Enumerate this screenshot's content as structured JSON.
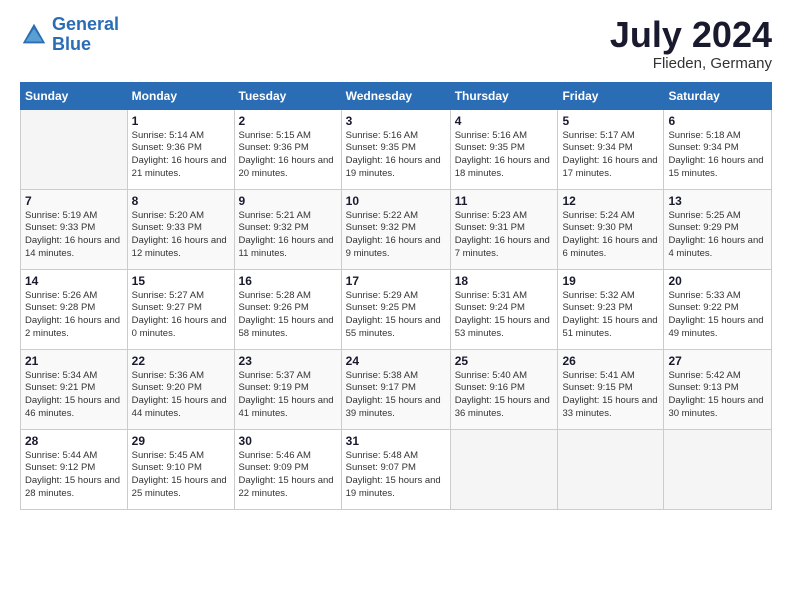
{
  "header": {
    "logo_line1": "General",
    "logo_line2": "Blue",
    "month": "July 2024",
    "location": "Flieden, Germany"
  },
  "weekdays": [
    "Sunday",
    "Monday",
    "Tuesday",
    "Wednesday",
    "Thursday",
    "Friday",
    "Saturday"
  ],
  "weeks": [
    [
      {
        "day": "",
        "empty": true
      },
      {
        "day": "1",
        "rise": "5:14 AM",
        "set": "9:36 PM",
        "daylight": "16 hours and 21 minutes."
      },
      {
        "day": "2",
        "rise": "5:15 AM",
        "set": "9:36 PM",
        "daylight": "16 hours and 20 minutes."
      },
      {
        "day": "3",
        "rise": "5:16 AM",
        "set": "9:35 PM",
        "daylight": "16 hours and 19 minutes."
      },
      {
        "day": "4",
        "rise": "5:16 AM",
        "set": "9:35 PM",
        "daylight": "16 hours and 18 minutes."
      },
      {
        "day": "5",
        "rise": "5:17 AM",
        "set": "9:34 PM",
        "daylight": "16 hours and 17 minutes."
      },
      {
        "day": "6",
        "rise": "5:18 AM",
        "set": "9:34 PM",
        "daylight": "16 hours and 15 minutes."
      }
    ],
    [
      {
        "day": "7",
        "rise": "5:19 AM",
        "set": "9:33 PM",
        "daylight": "16 hours and 14 minutes."
      },
      {
        "day": "8",
        "rise": "5:20 AM",
        "set": "9:33 PM",
        "daylight": "16 hours and 12 minutes."
      },
      {
        "day": "9",
        "rise": "5:21 AM",
        "set": "9:32 PM",
        "daylight": "16 hours and 11 minutes."
      },
      {
        "day": "10",
        "rise": "5:22 AM",
        "set": "9:32 PM",
        "daylight": "16 hours and 9 minutes."
      },
      {
        "day": "11",
        "rise": "5:23 AM",
        "set": "9:31 PM",
        "daylight": "16 hours and 7 minutes."
      },
      {
        "day": "12",
        "rise": "5:24 AM",
        "set": "9:30 PM",
        "daylight": "16 hours and 6 minutes."
      },
      {
        "day": "13",
        "rise": "5:25 AM",
        "set": "9:29 PM",
        "daylight": "16 hours and 4 minutes."
      }
    ],
    [
      {
        "day": "14",
        "rise": "5:26 AM",
        "set": "9:28 PM",
        "daylight": "16 hours and 2 minutes."
      },
      {
        "day": "15",
        "rise": "5:27 AM",
        "set": "9:27 PM",
        "daylight": "16 hours and 0 minutes."
      },
      {
        "day": "16",
        "rise": "5:28 AM",
        "set": "9:26 PM",
        "daylight": "15 hours and 58 minutes."
      },
      {
        "day": "17",
        "rise": "5:29 AM",
        "set": "9:25 PM",
        "daylight": "15 hours and 55 minutes."
      },
      {
        "day": "18",
        "rise": "5:31 AM",
        "set": "9:24 PM",
        "daylight": "15 hours and 53 minutes."
      },
      {
        "day": "19",
        "rise": "5:32 AM",
        "set": "9:23 PM",
        "daylight": "15 hours and 51 minutes."
      },
      {
        "day": "20",
        "rise": "5:33 AM",
        "set": "9:22 PM",
        "daylight": "15 hours and 49 minutes."
      }
    ],
    [
      {
        "day": "21",
        "rise": "5:34 AM",
        "set": "9:21 PM",
        "daylight": "15 hours and 46 minutes."
      },
      {
        "day": "22",
        "rise": "5:36 AM",
        "set": "9:20 PM",
        "daylight": "15 hours and 44 minutes."
      },
      {
        "day": "23",
        "rise": "5:37 AM",
        "set": "9:19 PM",
        "daylight": "15 hours and 41 minutes."
      },
      {
        "day": "24",
        "rise": "5:38 AM",
        "set": "9:17 PM",
        "daylight": "15 hours and 39 minutes."
      },
      {
        "day": "25",
        "rise": "5:40 AM",
        "set": "9:16 PM",
        "daylight": "15 hours and 36 minutes."
      },
      {
        "day": "26",
        "rise": "5:41 AM",
        "set": "9:15 PM",
        "daylight": "15 hours and 33 minutes."
      },
      {
        "day": "27",
        "rise": "5:42 AM",
        "set": "9:13 PM",
        "daylight": "15 hours and 30 minutes."
      }
    ],
    [
      {
        "day": "28",
        "rise": "5:44 AM",
        "set": "9:12 PM",
        "daylight": "15 hours and 28 minutes."
      },
      {
        "day": "29",
        "rise": "5:45 AM",
        "set": "9:10 PM",
        "daylight": "15 hours and 25 minutes."
      },
      {
        "day": "30",
        "rise": "5:46 AM",
        "set": "9:09 PM",
        "daylight": "15 hours and 22 minutes."
      },
      {
        "day": "31",
        "rise": "5:48 AM",
        "set": "9:07 PM",
        "daylight": "15 hours and 19 minutes."
      },
      {
        "day": "",
        "empty": true
      },
      {
        "day": "",
        "empty": true
      },
      {
        "day": "",
        "empty": true
      }
    ]
  ]
}
